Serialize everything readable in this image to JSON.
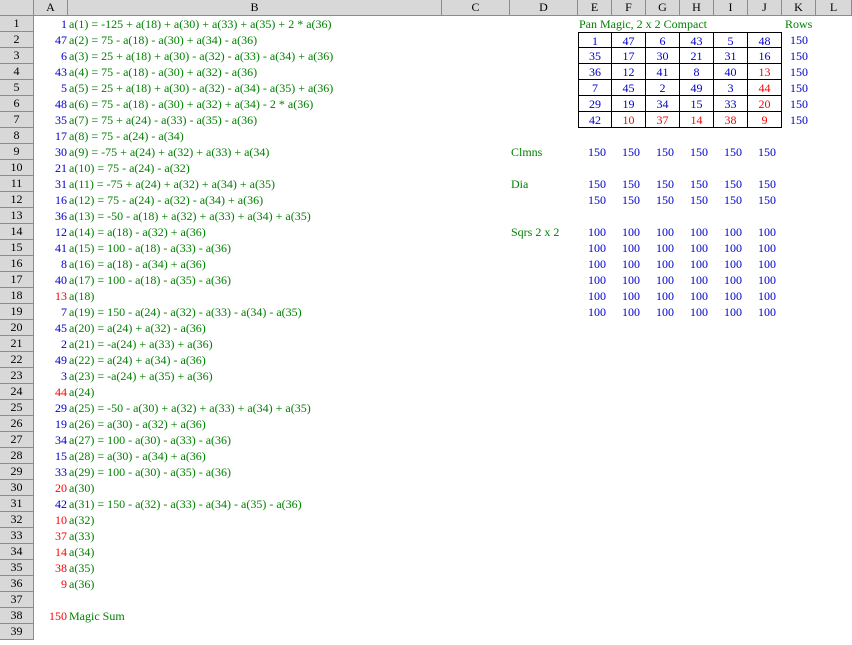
{
  "columns": [
    "A",
    "B",
    "C",
    "D",
    "E",
    "F",
    "G",
    "H",
    "I",
    "J",
    "K",
    "L"
  ],
  "rows": [
    "1",
    "2",
    "3",
    "4",
    "5",
    "6",
    "7",
    "8",
    "9",
    "10",
    "11",
    "12",
    "13",
    "14",
    "15",
    "16",
    "17",
    "18",
    "19",
    "20",
    "21",
    "22",
    "23",
    "24",
    "25",
    "26",
    "27",
    "28",
    "29",
    "30",
    "31",
    "32",
    "33",
    "34",
    "35",
    "36",
    "37",
    "38",
    "39"
  ],
  "colA": [
    {
      "v": "1",
      "c": "blue"
    },
    {
      "v": "47",
      "c": "blue"
    },
    {
      "v": "6",
      "c": "blue"
    },
    {
      "v": "43",
      "c": "blue"
    },
    {
      "v": "5",
      "c": "blue"
    },
    {
      "v": "48",
      "c": "blue"
    },
    {
      "v": "35",
      "c": "blue"
    },
    {
      "v": "17",
      "c": "blue"
    },
    {
      "v": "30",
      "c": "blue"
    },
    {
      "v": "21",
      "c": "blue"
    },
    {
      "v": "31",
      "c": "blue"
    },
    {
      "v": "16",
      "c": "blue"
    },
    {
      "v": "36",
      "c": "blue"
    },
    {
      "v": "12",
      "c": "blue"
    },
    {
      "v": "41",
      "c": "blue"
    },
    {
      "v": "8",
      "c": "blue"
    },
    {
      "v": "40",
      "c": "blue"
    },
    {
      "v": "13",
      "c": "red"
    },
    {
      "v": "7",
      "c": "blue"
    },
    {
      "v": "45",
      "c": "blue"
    },
    {
      "v": "2",
      "c": "blue"
    },
    {
      "v": "49",
      "c": "blue"
    },
    {
      "v": "3",
      "c": "blue"
    },
    {
      "v": "44",
      "c": "red"
    },
    {
      "v": "29",
      "c": "blue"
    },
    {
      "v": "19",
      "c": "blue"
    },
    {
      "v": "34",
      "c": "blue"
    },
    {
      "v": "15",
      "c": "blue"
    },
    {
      "v": "33",
      "c": "blue"
    },
    {
      "v": "20",
      "c": "red"
    },
    {
      "v": "42",
      "c": "blue"
    },
    {
      "v": "10",
      "c": "red"
    },
    {
      "v": "37",
      "c": "red"
    },
    {
      "v": "14",
      "c": "red"
    },
    {
      "v": "38",
      "c": "red"
    },
    {
      "v": "9",
      "c": "red"
    },
    {
      "v": "",
      "c": "blue"
    },
    {
      "v": "150",
      "c": "red"
    },
    {
      "v": "",
      "c": "blue"
    }
  ],
  "colB": [
    "a(1) = -125 + a(18) + a(30) + a(33) + a(35) + 2 * a(36)",
    "a(2) = 75 - a(18) - a(30) + a(34) - a(36)",
    "a(3) = 25 + a(18) + a(30) - a(32) - a(33) - a(34) + a(36)",
    "a(4) = 75 - a(18) - a(30) + a(32) - a(36)",
    "a(5) = 25 + a(18) + a(30) - a(32) - a(34) - a(35) + a(36)",
    "a(6) = 75 - a(18) - a(30) + a(32) + a(34) - 2 * a(36)",
    "a(7) = 75 + a(24) - a(33) - a(35) - a(36)",
    "a(8) = 75 - a(24) - a(34)",
    "a(9) = -75 + a(24) + a(32) + a(33) + a(34)",
    "a(10) = 75 - a(24) - a(32)",
    "a(11) = -75 + a(24) + a(32) + a(34) + a(35)",
    "a(12) = 75 - a(24) - a(32) - a(34) + a(36)",
    "a(13) = -50 - a(18) + a(32) + a(33) + a(34) + a(35)",
    "a(14) = a(18) - a(32) + a(36)",
    "a(15) = 100 - a(18) - a(33) - a(36)",
    "a(16) = a(18) - a(34) + a(36)",
    "a(17) = 100 - a(18) - a(35) - a(36)",
    "a(18)",
    "a(19) = 150 - a(24) - a(32) - a(33) - a(34) - a(35)",
    "a(20) = a(24) + a(32) - a(36)",
    "a(21) = -a(24) + a(33) + a(36)",
    "a(22) = a(24) + a(34) - a(36)",
    "a(23) = -a(24) + a(35) + a(36)",
    "a(24)",
    "a(25) = -50 - a(30) + a(32) + a(33) + a(34) + a(35)",
    "a(26) = a(30) - a(32) + a(36)",
    "a(27) = 100 - a(30) - a(33) - a(36)",
    "a(28) = a(30) - a(34) + a(36)",
    "a(29) = 100 - a(30) - a(35) - a(36)",
    "a(30)",
    "a(31) = 150 - a(32) - a(33) - a(34) - a(35) - a(36)",
    "a(32)",
    "a(33)",
    "a(34)",
    "a(35)",
    "a(36)",
    "",
    "Magic Sum",
    ""
  ],
  "square": {
    "title": "Pan Magic, 2 x 2 Compact",
    "rows_label": "Rows",
    "grid": [
      [
        {
          "v": "1",
          "c": "blue"
        },
        {
          "v": "47",
          "c": "blue"
        },
        {
          "v": "6",
          "c": "blue"
        },
        {
          "v": "43",
          "c": "blue"
        },
        {
          "v": "5",
          "c": "blue"
        },
        {
          "v": "48",
          "c": "blue"
        }
      ],
      [
        {
          "v": "35",
          "c": "blue"
        },
        {
          "v": "17",
          "c": "blue"
        },
        {
          "v": "30",
          "c": "blue"
        },
        {
          "v": "21",
          "c": "blue"
        },
        {
          "v": "31",
          "c": "blue"
        },
        {
          "v": "16",
          "c": "blue"
        }
      ],
      [
        {
          "v": "36",
          "c": "blue"
        },
        {
          "v": "12",
          "c": "blue"
        },
        {
          "v": "41",
          "c": "blue"
        },
        {
          "v": "8",
          "c": "blue"
        },
        {
          "v": "40",
          "c": "blue"
        },
        {
          "v": "13",
          "c": "red"
        }
      ],
      [
        {
          "v": "7",
          "c": "blue"
        },
        {
          "v": "45",
          "c": "blue"
        },
        {
          "v": "2",
          "c": "blue"
        },
        {
          "v": "49",
          "c": "blue"
        },
        {
          "v": "3",
          "c": "blue"
        },
        {
          "v": "44",
          "c": "red"
        }
      ],
      [
        {
          "v": "29",
          "c": "blue"
        },
        {
          "v": "19",
          "c": "blue"
        },
        {
          "v": "34",
          "c": "blue"
        },
        {
          "v": "15",
          "c": "blue"
        },
        {
          "v": "33",
          "c": "blue"
        },
        {
          "v": "20",
          "c": "red"
        }
      ],
      [
        {
          "v": "42",
          "c": "blue"
        },
        {
          "v": "10",
          "c": "red"
        },
        {
          "v": "37",
          "c": "red"
        },
        {
          "v": "14",
          "c": "red"
        },
        {
          "v": "38",
          "c": "red"
        },
        {
          "v": "9",
          "c": "red"
        }
      ]
    ],
    "row_sums": [
      "150",
      "150",
      "150",
      "150",
      "150",
      "150"
    ]
  },
  "checks": {
    "clmns_label": "Clmns",
    "clmns": [
      "150",
      "150",
      "150",
      "150",
      "150",
      "150"
    ],
    "dia_label": "Dia",
    "dia": [
      [
        "150",
        "150",
        "150",
        "150",
        "150",
        "150"
      ],
      [
        "150",
        "150",
        "150",
        "150",
        "150",
        "150"
      ]
    ],
    "sqrs_label": "Sqrs 2 x 2",
    "sqrs": [
      [
        "100",
        "100",
        "100",
        "100",
        "100",
        "100"
      ],
      [
        "100",
        "100",
        "100",
        "100",
        "100",
        "100"
      ],
      [
        "100",
        "100",
        "100",
        "100",
        "100",
        "100"
      ],
      [
        "100",
        "100",
        "100",
        "100",
        "100",
        "100"
      ],
      [
        "100",
        "100",
        "100",
        "100",
        "100",
        "100"
      ],
      [
        "100",
        "100",
        "100",
        "100",
        "100",
        "100"
      ]
    ]
  },
  "colors": {
    "header_bg": "#d8d8d8",
    "green": "#008000",
    "blue": "#0000cc",
    "red": "#ff0000"
  }
}
